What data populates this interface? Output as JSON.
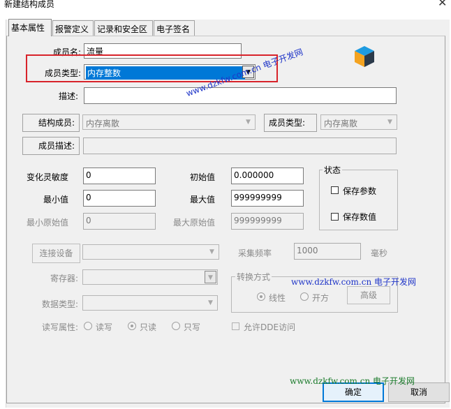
{
  "window": {
    "title": "新建结构成员",
    "close_glyph": "✕"
  },
  "tabs": [
    {
      "label": "基本属性",
      "active": true
    },
    {
      "label": "报警定义",
      "active": false
    },
    {
      "label": "记录和安全区",
      "active": false
    },
    {
      "label": "电子签名",
      "active": false
    }
  ],
  "member": {
    "name_label": "成员名:",
    "name_value": "流量",
    "type_label": "成员类型:",
    "type_value": "内存整数",
    "desc_label": "描述:",
    "desc_value": ""
  },
  "struct": {
    "member_label": "结构成员:",
    "member_value": "内存离散",
    "member_type_label": "成员类型:",
    "member_type_value": "内存离散",
    "member_desc_label": "成员描述:",
    "member_desc_value": ""
  },
  "params": {
    "sensitivity_label": "变化灵敏度",
    "sensitivity_value": "0",
    "initial_label": "初始值",
    "initial_value": "0.000000",
    "min_label": "最小值",
    "min_value": "0",
    "max_label": "最大值",
    "max_value": "999999999",
    "min_raw_label": "最小原始值",
    "min_raw_value": "0",
    "max_raw_label": "最大原始值",
    "max_raw_value": "999999999"
  },
  "status_group": {
    "title": "状态",
    "save_params_label": "保存参数",
    "save_values_label": "保存数值"
  },
  "io": {
    "connect_button": "连接设备",
    "device_value": "",
    "sample_label": "采集频率",
    "sample_value": "1000",
    "sample_unit": "毫秒",
    "register_label": "寄存器:",
    "datatype_label": "数据类型:",
    "rw_label": "读写属性:",
    "rw_options": [
      "读写",
      "只读",
      "只写"
    ],
    "dde_label": "允许DDE访问"
  },
  "convert_group": {
    "title": "转换方式",
    "linear_label": "线性",
    "sqrt_label": "开方",
    "advanced_button": "高级"
  },
  "footer": {
    "ok_button": "确定",
    "cancel_button": "取消"
  },
  "watermarks": {
    "diagonal": "www.dzkfw.com.cn 电子开发网",
    "middle": "www.dzkfw.com.cn 电子开发网",
    "bottom": "www.dzkfw.com.cn 电子开发网"
  },
  "colors": {
    "selection": "#0078d7",
    "highlight_frame": "#d8232a",
    "watermark_blue": "#1f35c8",
    "watermark_green": "#1a7a2a"
  }
}
